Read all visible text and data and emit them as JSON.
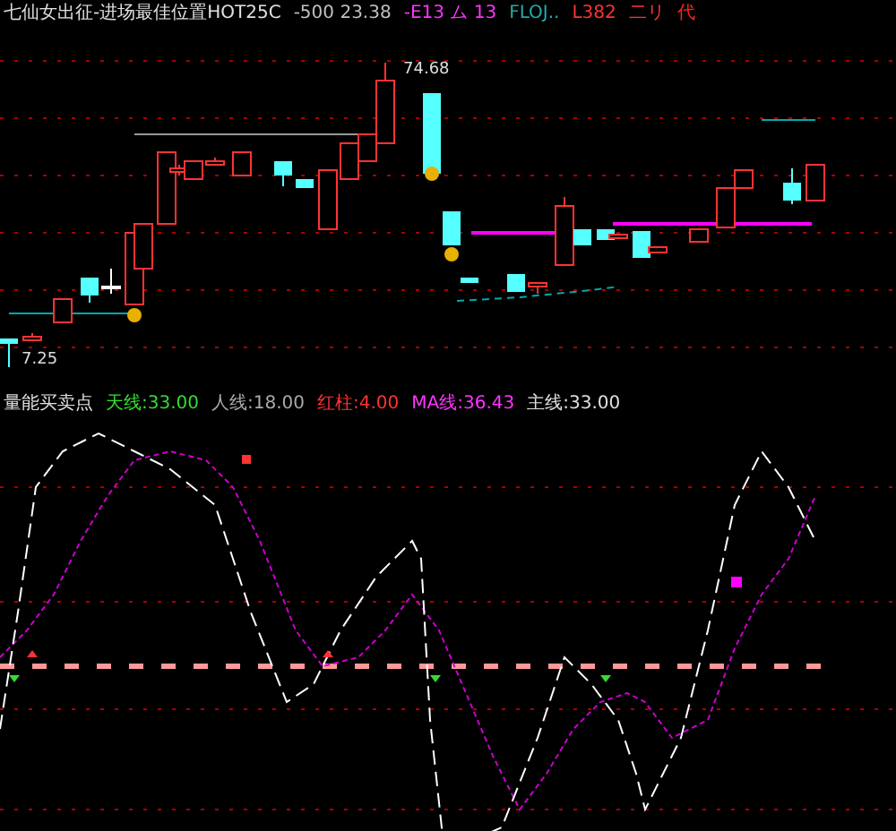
{
  "price_panel": {
    "header": [
      {
        "text": "七仙女出征-进场最佳位置HOT25C",
        "color": "#e0e0e0"
      },
      {
        "text": "-500 23.38",
        "color": "#c0c0c0"
      },
      {
        "text": "-E13 ム 13",
        "color": "#ff33ff"
      },
      {
        "text": "FLOJ..",
        "color": "#22aaaa"
      },
      {
        "text": "L382",
        "color": "#ff3333"
      },
      {
        "text": "二リ",
        "color": "#ff3333"
      },
      {
        "text": "代",
        "color": "#ff2222"
      }
    ],
    "high_label": "74.68",
    "low_label": "7.25"
  },
  "indicator_panel": {
    "header": [
      {
        "text": "量能买卖点",
        "color": "#e0e0e0"
      },
      {
        "text": "天线:33.00",
        "color": "#33dd33"
      },
      {
        "text": "人线:18.00",
        "color": "#aaaaaa"
      },
      {
        "text": "红柱:4.00",
        "color": "#ff3333"
      },
      {
        "text": "MA线:36.43",
        "color": "#ff33ff"
      },
      {
        "text": "主线:33.00",
        "color": "#e0e0e0"
      }
    ]
  }
}
